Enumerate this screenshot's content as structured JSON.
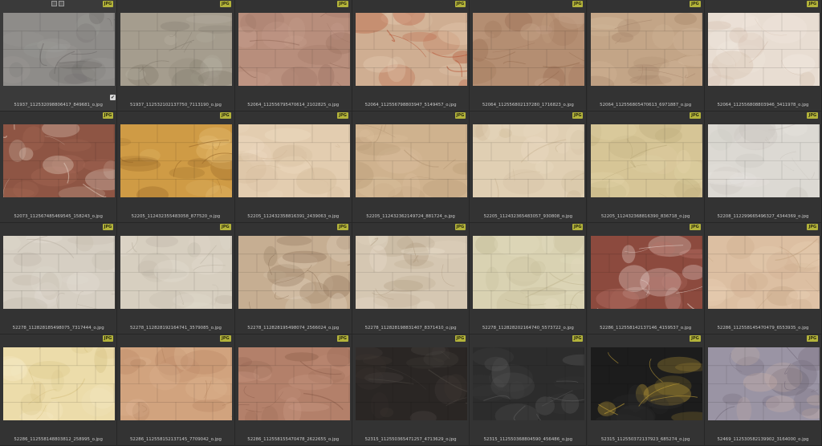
{
  "badge_label": "JPG",
  "rows": [
    [
      {
        "filename": "51937_112532098806417_849681_o.jpg",
        "base": "#8e8c89",
        "light": "#a19e9a",
        "vein": "#6f6d6a",
        "selected": true
      },
      {
        "filename": "51937_112532102137750_7113190_o.jpg",
        "base": "#a59d8e",
        "light": "#b9b2a4",
        "vein": "#857d6f"
      },
      {
        "filename": "52064_112556795470614_2102825_o.jpg",
        "base": "#b88e7c",
        "light": "#c9a08f",
        "vein": "#986e5e"
      },
      {
        "filename": "52064_112556798803947_5149457_o.jpg",
        "base": "#cfae92",
        "light": "#e6cdb3",
        "vein": "#b8593a"
      },
      {
        "filename": "52064_112556802137280_1716823_o.jpg",
        "base": "#b48e72",
        "light": "#c7a58b",
        "vein": "#9a6f54"
      },
      {
        "filename": "52064_112556805470613_6971887_o.jpg",
        "base": "#c3a587",
        "light": "#d8bea2",
        "vein": "#a7866a"
      },
      {
        "filename": "52064_112556808803946_3411978_o.jpg",
        "base": "#e8ddd2",
        "light": "#f3ebe3",
        "vein": "#d6c2b1"
      }
    ],
    [
      {
        "filename": "52073_112567485469545_158243_o.jpg",
        "base": "#8e5544",
        "light": "#a86a56",
        "vein": "#dcc7b8"
      },
      {
        "filename": "52205_112432355483058_877520_o.jpg",
        "base": "#cf9b45",
        "light": "#e8c27a",
        "vein": "#9c6a2a"
      },
      {
        "filename": "52205_112432358816391_2439063_o.jpg",
        "base": "#e3cdb0",
        "light": "#efdcc2",
        "vein": "#d4bb9b"
      },
      {
        "filename": "52205_112432362149724_881724_o.jpg",
        "base": "#cfb28e",
        "light": "#dcc2a0",
        "vein": "#b89a76"
      },
      {
        "filename": "52205_112432365483057_930808_o.jpg",
        "base": "#e0cfb3",
        "light": "#ecdec6",
        "vein": "#cdb999"
      },
      {
        "filename": "52205_112432368816390_836718_o.jpg",
        "base": "#d6c596",
        "light": "#e2d3a8",
        "vein": "#bcab7c"
      },
      {
        "filename": "52208_112299665496327_4344369_o.jpg",
        "base": "#dcd9d3",
        "light": "#e8e5e0",
        "vein": "#c9c5be"
      }
    ],
    [
      {
        "filename": "52278_112828185498075_7317444_o.jpg",
        "base": "#d6cfc3",
        "light": "#e3ddd2",
        "vein": "#bdb4a6"
      },
      {
        "filename": "52278_112828192164741_3579085_o.jpg",
        "base": "#d7cfc0",
        "light": "#e4ddd0",
        "vein": "#beb5a5"
      },
      {
        "filename": "52278_112828195498074_2566024_o.jpg",
        "base": "#c6ae92",
        "light": "#e2d3c0",
        "vein": "#8f7358"
      },
      {
        "filename": "52278_112828198831407_8371410_o.jpg",
        "base": "#d5c7b2",
        "light": "#e8ddcc",
        "vein": "#b39f84"
      },
      {
        "filename": "52278_112828202164740_5573722_o.jpg",
        "base": "#d9d2b2",
        "light": "#e6dfc3",
        "vein": "#c1b893"
      },
      {
        "filename": "52286_112558142137146_4159537_o.jpg",
        "base": "#8c4a3e",
        "light": "#b8746a",
        "vein": "#e8d8d2"
      },
      {
        "filename": "52286_112558145470479_6553935_o.jpg",
        "base": "#dcbfa2",
        "light": "#e8cfb5",
        "vein": "#c7a686"
      }
    ],
    [
      {
        "filename": "52286_112558148803812_258995_o.jpg",
        "base": "#ecdcaa",
        "light": "#f6ebc6",
        "vein": "#d8c384"
      },
      {
        "filename": "52286_112558152137145_7709042_o.jpg",
        "base": "#d1a37e",
        "light": "#ddb592",
        "vein": "#b88763"
      },
      {
        "filename": "52286_112558155470478_2622655_o.jpg",
        "base": "#b3806a",
        "light": "#c99884",
        "vein": "#8f5f4c"
      },
      {
        "filename": "52315_112550365471257_4713629_o.jpg",
        "base": "#2a2624",
        "light": "#3a3430",
        "vein": "#4a4440"
      },
      {
        "filename": "52315_112550368804590_456486_o.jpg",
        "base": "#2c2c2c",
        "light": "#3b3b3b",
        "vein": "#5a5a5a"
      },
      {
        "filename": "52315_112550372137923_685274_o.jpg",
        "base": "#1c1c1c",
        "light": "#2b2b2b",
        "vein": "#c9a73a"
      },
      {
        "filename": "52469_112530582139902_3164000_o.jpg",
        "base": "#9a94a4",
        "light": "#c8b0a8",
        "vein": "#6e6474"
      }
    ]
  ]
}
